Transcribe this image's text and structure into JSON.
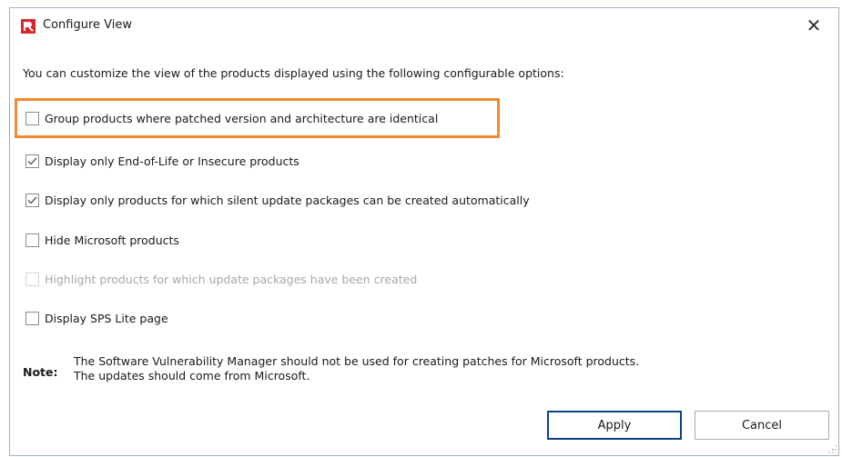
{
  "window": {
    "title": "Configure View",
    "close_glyph": "✕",
    "app_icon": "app-logo-icon",
    "close_icon": "close-icon"
  },
  "intro": "You can customize the view of the products displayed using the following configurable options:",
  "options": [
    {
      "label": "Group products where patched version and architecture are identical",
      "checked": false,
      "enabled": true,
      "highlighted": true
    },
    {
      "label": "Display only End-of-Life or Insecure products",
      "checked": true,
      "enabled": true
    },
    {
      "label": "Display only products for which silent update packages can be created automatically",
      "checked": true,
      "enabled": true
    },
    {
      "label": "Hide Microsoft products",
      "checked": false,
      "enabled": true
    },
    {
      "label": "Highlight products for which update packages have been created",
      "checked": false,
      "enabled": false
    },
    {
      "label": "Display SPS Lite page",
      "checked": false,
      "enabled": true
    }
  ],
  "note": {
    "label": "Note:",
    "line1": "The Software Vulnerability Manager should not be used for creating patches for Microsoft products.",
    "line2": "The updates should come from Microsoft."
  },
  "buttons": {
    "apply": "Apply",
    "cancel": "Cancel"
  },
  "colors": {
    "highlight": "#f28a2e",
    "primary_border": "#0b3f8a",
    "app_icon": "#d8262d"
  }
}
